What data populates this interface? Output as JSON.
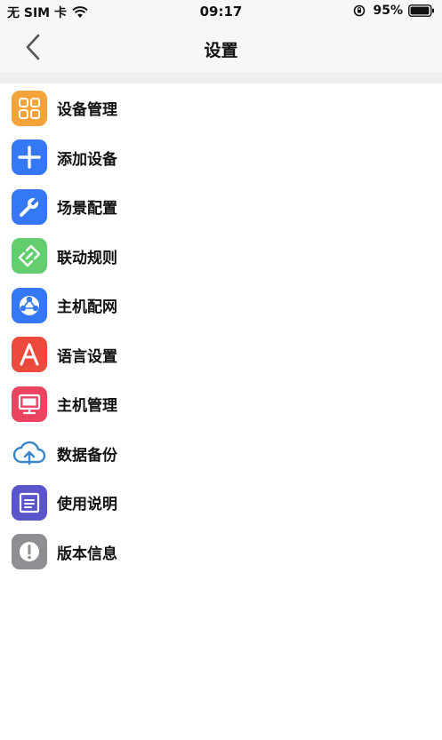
{
  "status_bar": {
    "carrier": "无 SIM 卡",
    "time": "09:17",
    "battery": "95%"
  },
  "nav": {
    "title": "设置"
  },
  "menu": {
    "items": [
      {
        "label": "设备管理",
        "icon": "grid-icon",
        "color": "#F2A33A"
      },
      {
        "label": "添加设备",
        "icon": "plus-icon",
        "color": "#3478F6"
      },
      {
        "label": "场景配置",
        "icon": "wrench-icon",
        "color": "#3478F6"
      },
      {
        "label": "联动规则",
        "icon": "link-icon",
        "color": "#62CE6E"
      },
      {
        "label": "主机配网",
        "icon": "network-icon",
        "color": "#3478F6"
      },
      {
        "label": "语言设置",
        "icon": "letter-a-icon",
        "color": "#EC4A3C"
      },
      {
        "label": "主机管理",
        "icon": "monitor-icon",
        "color": "#E94560"
      },
      {
        "label": "数据备份",
        "icon": "cloud-upload-icon",
        "color": "#3A86C8"
      },
      {
        "label": "使用说明",
        "icon": "document-icon",
        "color": "#5A55C9"
      },
      {
        "label": "版本信息",
        "icon": "info-icon",
        "color": "#8E8E93"
      }
    ]
  }
}
